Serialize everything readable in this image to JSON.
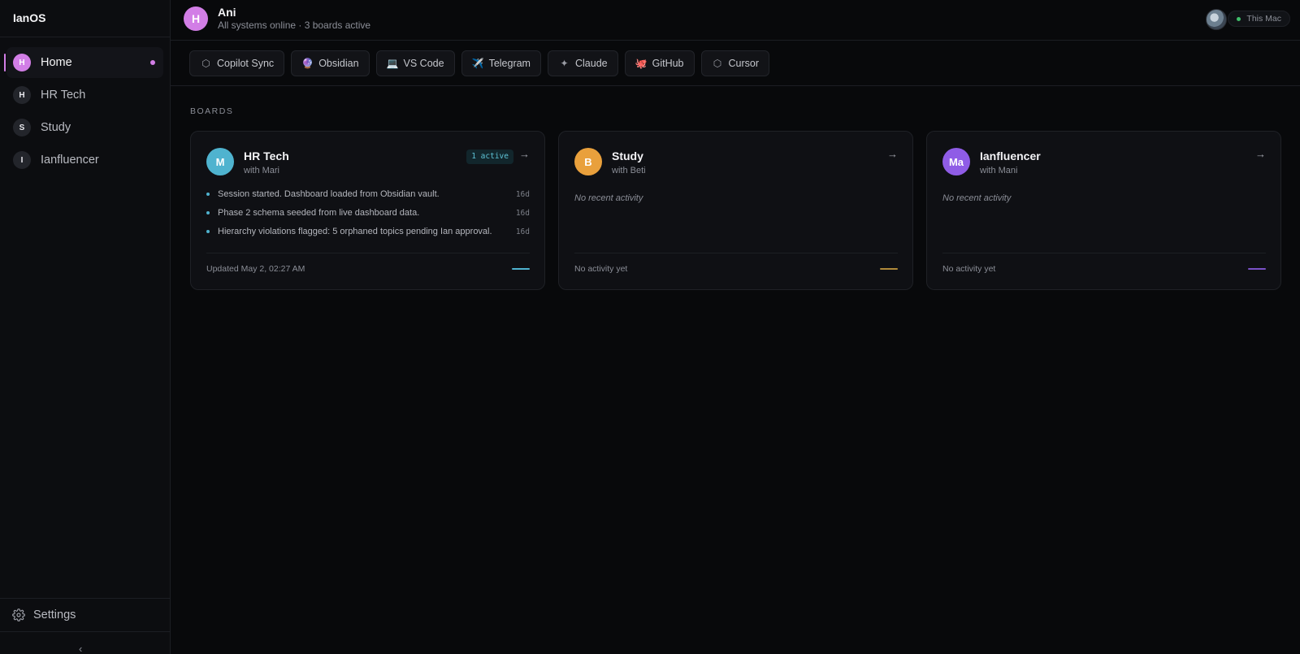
{
  "app": {
    "name": "IanOS"
  },
  "sidebar": {
    "items": [
      {
        "initial": "H",
        "label": "Home",
        "active": true
      },
      {
        "initial": "H",
        "label": "HR Tech"
      },
      {
        "initial": "S",
        "label": "Study"
      },
      {
        "initial": "I",
        "label": "Ianfluencer"
      }
    ],
    "settings_label": "Settings",
    "collapse_icon": "‹"
  },
  "header": {
    "avatar_initial": "H",
    "name": "Ani",
    "status": "All systems online · 3 boards active",
    "device_label": "This Mac"
  },
  "toolbar": {
    "chips": [
      {
        "icon": "⬡",
        "label": "Copilot Sync"
      },
      {
        "icon": "🔮",
        "label": "Obsidian"
      },
      {
        "icon": "💻",
        "label": "VS Code"
      },
      {
        "icon": "✈️",
        "label": "Telegram"
      },
      {
        "icon": "✦",
        "label": "Claude"
      },
      {
        "icon": "🐙",
        "label": "GitHub"
      },
      {
        "icon": "⬡",
        "label": "Cursor"
      }
    ]
  },
  "boards": {
    "section_title": "BOARDS",
    "cards": [
      {
        "avatar": "M",
        "title": "HR Tech",
        "subtitle": "with Mari",
        "badge": "1 active",
        "arrow": "→",
        "activity": [
          {
            "text": "Session started. Dashboard loaded from Obsidian vault.",
            "time": "16d"
          },
          {
            "text": "Phase 2 schema seeded from live dashboard data.",
            "time": "16d"
          },
          {
            "text": "Hierarchy violations flagged: 5 orphaned topics pending Ian approval.",
            "time": "16d"
          }
        ],
        "footer": "Updated May 2, 02:27 AM",
        "color": "#4fb3cf"
      },
      {
        "avatar": "B",
        "title": "Study",
        "subtitle": "with Beti",
        "arrow": "→",
        "empty_text": "No recent activity",
        "footer": "No activity yet",
        "color": "#e9a03c"
      },
      {
        "avatar": "Ma",
        "title": "Ianfluencer",
        "subtitle": "with Mani",
        "arrow": "→",
        "empty_text": "No recent activity",
        "footer": "No activity yet",
        "color": "#8f5ce6"
      }
    ]
  }
}
